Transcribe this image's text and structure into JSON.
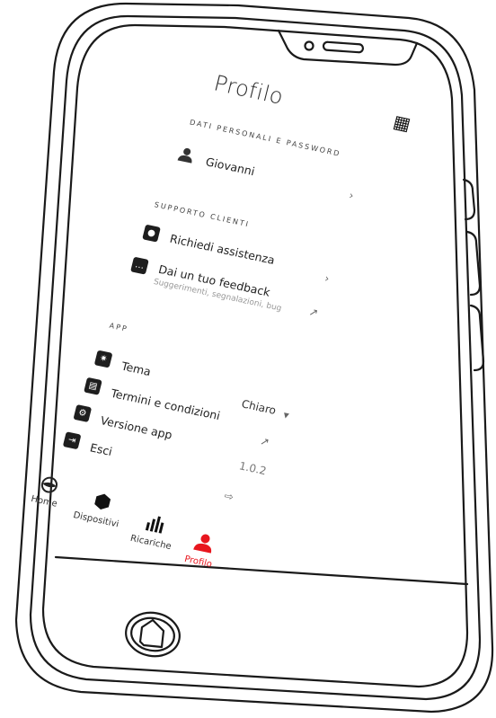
{
  "header": {
    "title": "Profilo",
    "qr_icon": "qr-code-icon"
  },
  "sections": {
    "personal": {
      "heading": "DATI PERSONALI E PASSWORD",
      "user_name": "Giovanni"
    },
    "support": {
      "heading": "SUPPORTO CLIENTI",
      "assistance_label": "Richiedi assistenza",
      "feedback_label": "Dai un tuo feedback",
      "feedback_sub": "Suggerimenti, segnalazioni, bug"
    },
    "app": {
      "heading": "APP",
      "theme_label": "Tema",
      "theme_value": "Chiaro",
      "terms_label": "Termini e condizioni",
      "version_label": "Versione app",
      "version_value": "1.0.2",
      "logout_label": "Esci"
    }
  },
  "nav": {
    "items": [
      {
        "label": "Home",
        "icon": "globe-icon"
      },
      {
        "label": "Dispositivi",
        "icon": "hexagon-icon"
      },
      {
        "label": "Ricariche",
        "icon": "bar-chart-icon"
      },
      {
        "label": "Profilo",
        "icon": "user-icon",
        "active": true
      }
    ]
  },
  "colors": {
    "accent": "#e8161e",
    "icon_box": "#1e1e1e",
    "outline": "#1a1a1a"
  }
}
